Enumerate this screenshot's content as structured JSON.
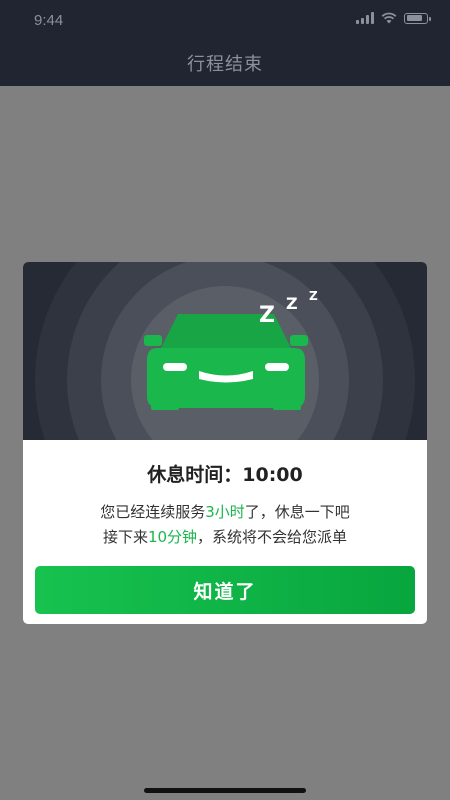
{
  "status_bar": {
    "time": "9:44",
    "battery_level": 0.85
  },
  "nav": {
    "title": "行程结束"
  },
  "modal": {
    "illustration": {
      "sleep_glyphs": [
        "Z",
        "Z",
        "Z"
      ],
      "car_color": "#1ab74d"
    },
    "rest_title_prefix": "休息时间：",
    "rest_time": "10:00",
    "desc_line1_a": "您已经连续服务",
    "desc_line1_highlight": "3小时",
    "desc_line1_b": "了，休息一下吧",
    "desc_line2_a": "接下来",
    "desc_line2_highlight": "10分钟",
    "desc_line2_b": "，系统将不会给您派单",
    "confirm_label": "知道了"
  },
  "colors": {
    "accent": "#1ab74d",
    "dim_overlay": "#808080",
    "header_bg": "#212531"
  }
}
